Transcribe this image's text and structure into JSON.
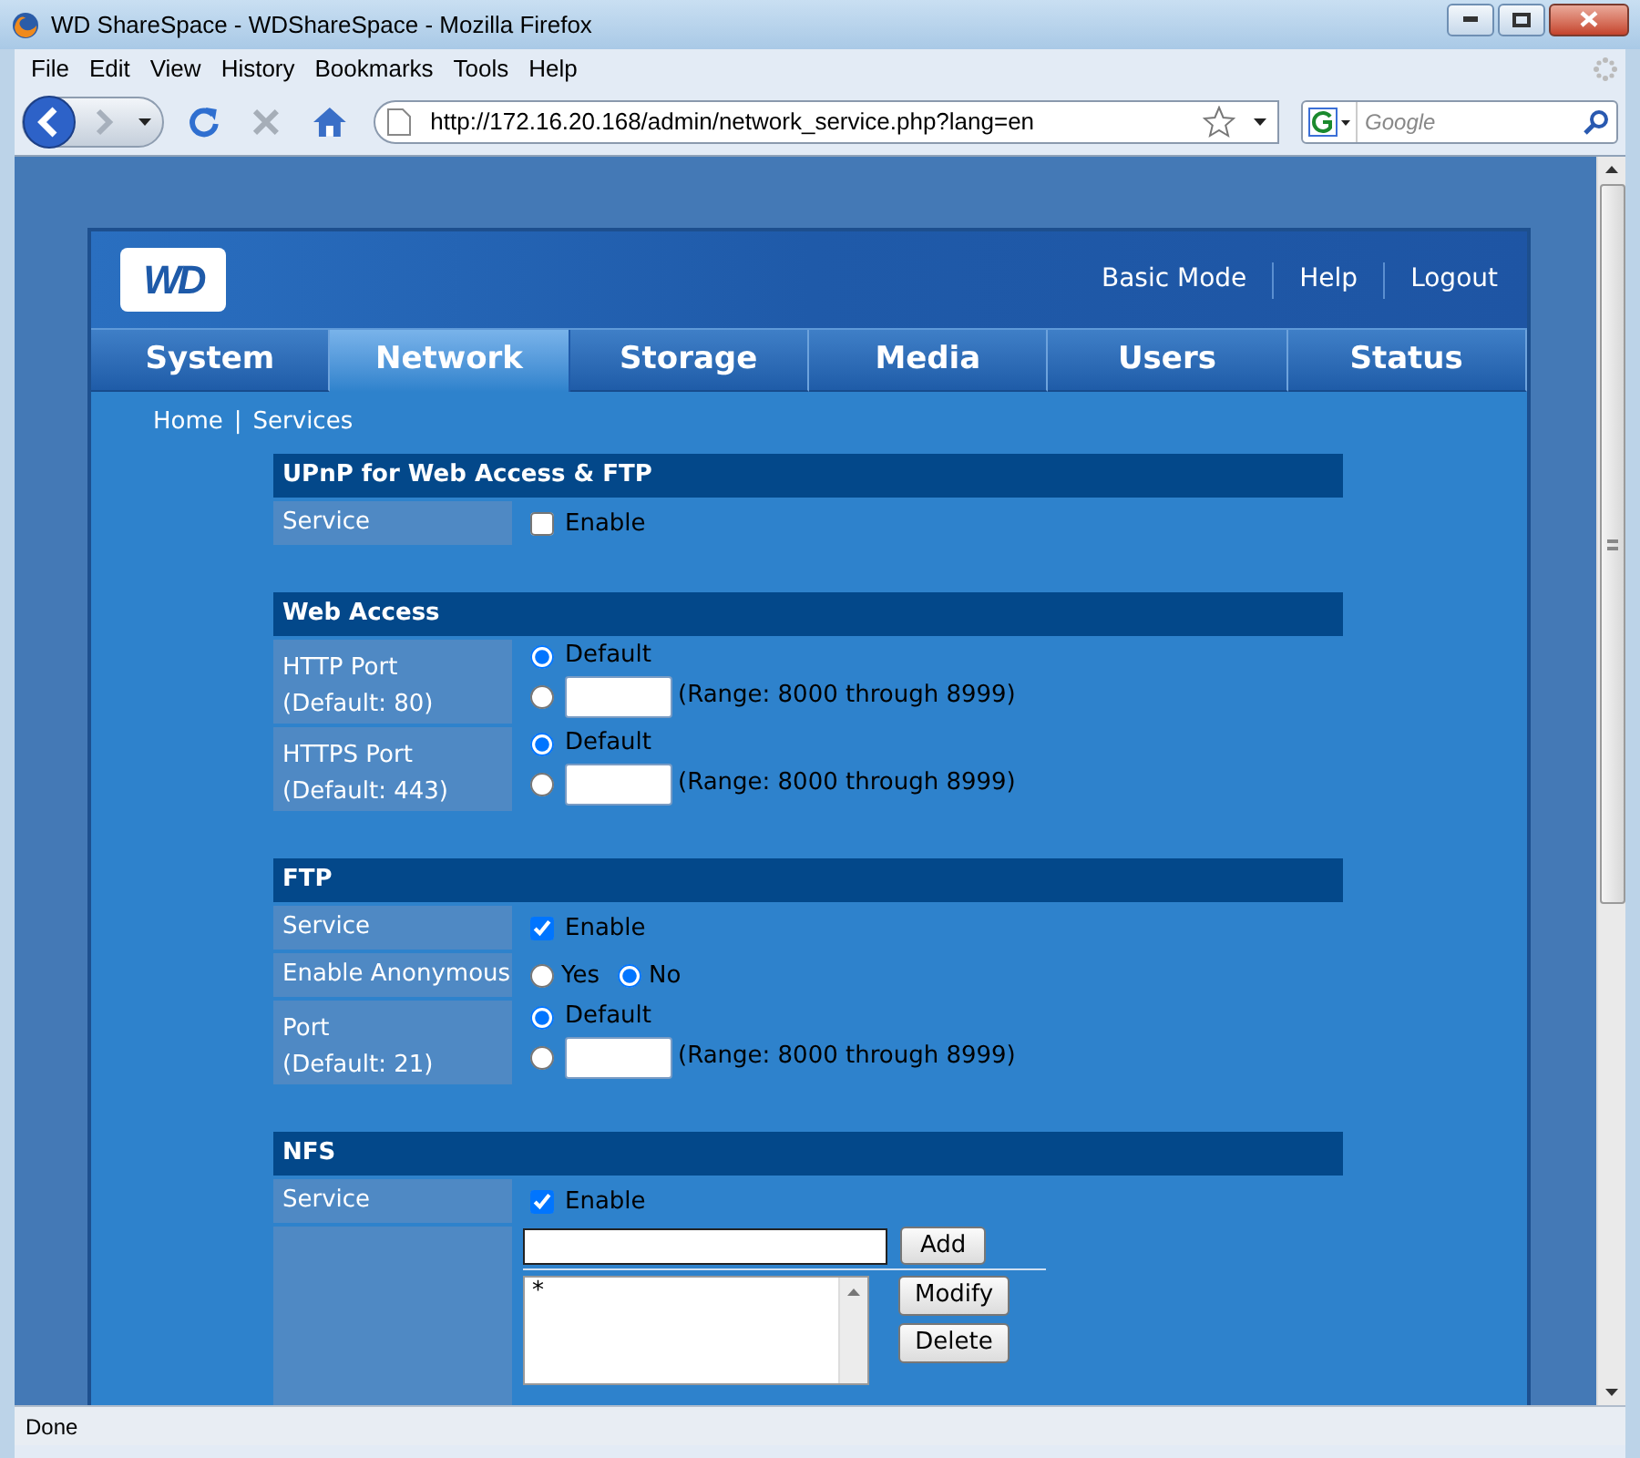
{
  "window": {
    "title": "WD ShareSpace - WDShareSpace - Mozilla Firefox"
  },
  "menu": [
    "File",
    "Edit",
    "View",
    "History",
    "Bookmarks",
    "Tools",
    "Help"
  ],
  "toolbar": {
    "url": "http://172.16.20.168/admin/network_service.php?lang=en",
    "search_placeholder": "Google"
  },
  "header": {
    "logo": "WD",
    "links": [
      "Basic Mode",
      "Help",
      "Logout"
    ]
  },
  "tabs": [
    {
      "label": "System",
      "selected": false
    },
    {
      "label": "Network",
      "selected": true
    },
    {
      "label": "Storage",
      "selected": false
    },
    {
      "label": "Media",
      "selected": false
    },
    {
      "label": "Users",
      "selected": false
    },
    {
      "label": "Status",
      "selected": false
    }
  ],
  "breadcrumb": {
    "items": [
      "Home",
      "Services"
    ],
    "separator": "|"
  },
  "sections": [
    {
      "title": "UPnP for Web Access & FTP",
      "rows": [
        {
          "kind": "checkbox",
          "label": "Service",
          "text": "Enable",
          "checked": false
        }
      ]
    },
    {
      "title": "Web Access",
      "rows": [
        {
          "kind": "port",
          "label": "HTTP Port",
          "note": "(Default: 80)",
          "default_text": "Default",
          "default_selected": true,
          "custom_selected": false,
          "hint": "(Range: 8000 through 8999)"
        },
        {
          "kind": "port",
          "label": "HTTPS Port",
          "note": "(Default: 443)",
          "default_text": "Default",
          "default_selected": true,
          "custom_selected": false,
          "hint": "(Range: 8000 through 8999)"
        }
      ]
    },
    {
      "title": "FTP",
      "rows": [
        {
          "kind": "checkbox",
          "label": "Service",
          "text": "Enable",
          "checked": true
        },
        {
          "kind": "radios",
          "label": "Enable Anonymous",
          "options": [
            {
              "text": "Yes",
              "selected": false
            },
            {
              "text": "No",
              "selected": true
            }
          ]
        },
        {
          "kind": "port",
          "label": "Port",
          "note": "(Default: 21)",
          "default_text": "Default",
          "default_selected": true,
          "custom_selected": false,
          "hint": "(Range: 8000 through 8999)"
        }
      ]
    },
    {
      "title": "NFS",
      "rows": [
        {
          "kind": "checkbox",
          "label": "Service",
          "text": "Enable",
          "checked": true
        },
        {
          "kind": "list_editor",
          "add": "Add",
          "items": [
            "*"
          ],
          "buttons": [
            "Modify",
            "Delete"
          ]
        }
      ]
    }
  ],
  "status_bar": "Done"
}
